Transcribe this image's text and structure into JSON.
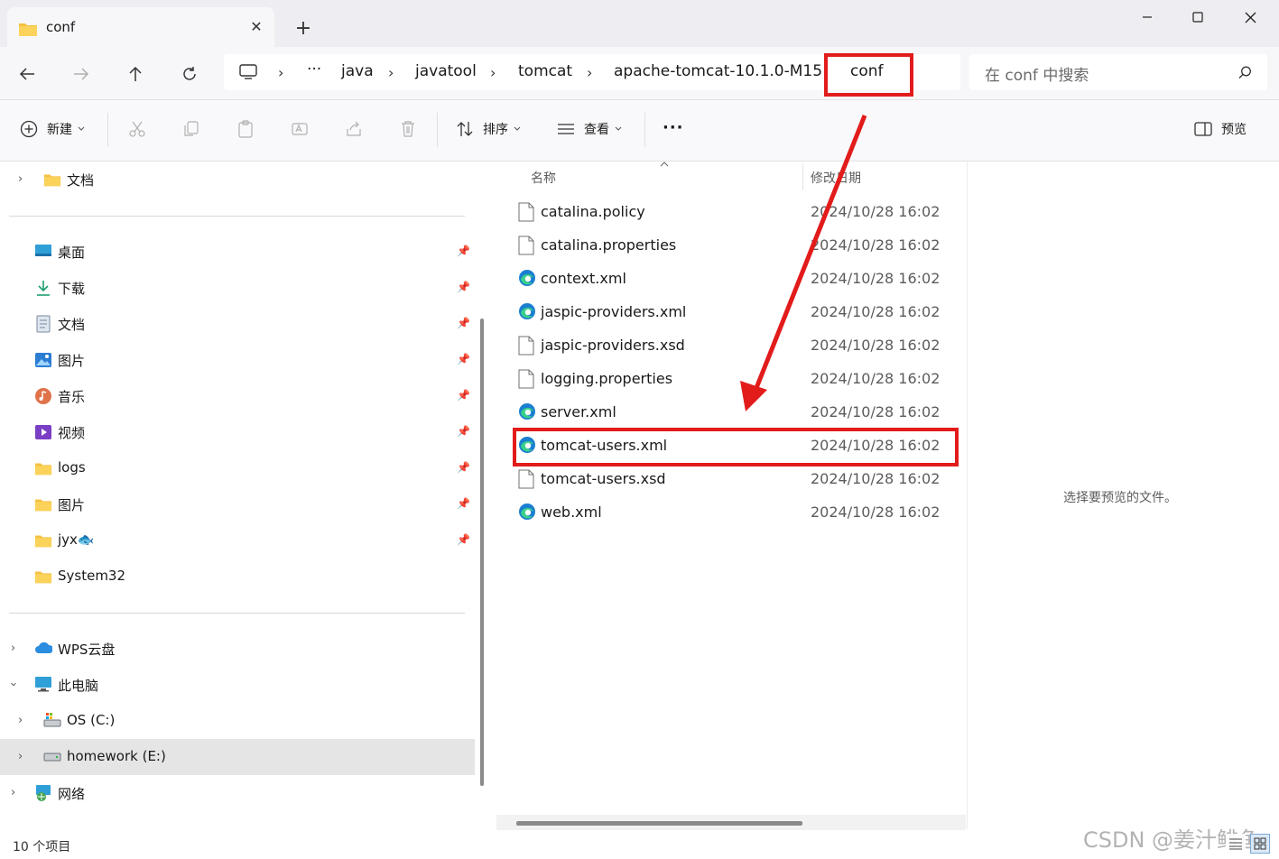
{
  "window": {
    "tab_title": "conf",
    "tab_close": "✕",
    "new_tab": "+"
  },
  "address_bar": {
    "ellipsis": "···",
    "crumbs": [
      "java",
      "javatool",
      "tomcat",
      "apache-tomcat-10.1.0-M15",
      "conf"
    ],
    "separator": "›"
  },
  "search": {
    "placeholder": "在 conf 中搜索"
  },
  "toolbar": {
    "new_label": "新建",
    "sort_label": "排序",
    "view_label": "查看",
    "more_label": "···",
    "preview_label": "预览"
  },
  "sidebar": {
    "top_item": "文档",
    "quick_access": [
      "桌面",
      "下载",
      "文档",
      "图片",
      "音乐",
      "视频",
      "logs",
      "图片",
      "jyx🐟",
      "System32"
    ],
    "wps": "WPS云盘",
    "this_pc": "此电脑",
    "drives": [
      "OS (C:)",
      "homework (E:)"
    ],
    "network": "网络"
  },
  "file_list": {
    "col_name": "名称",
    "col_date": "修改日期",
    "files": [
      {
        "name": "catalina.policy",
        "date": "2024/10/28 16:02",
        "icon": "file-icon"
      },
      {
        "name": "catalina.properties",
        "date": "2024/10/28 16:02",
        "icon": "file-icon"
      },
      {
        "name": "context.xml",
        "date": "2024/10/28 16:02",
        "icon": "edge-icon"
      },
      {
        "name": "jaspic-providers.xml",
        "date": "2024/10/28 16:02",
        "icon": "edge-icon"
      },
      {
        "name": "jaspic-providers.xsd",
        "date": "2024/10/28 16:02",
        "icon": "file-icon"
      },
      {
        "name": "logging.properties",
        "date": "2024/10/28 16:02",
        "icon": "file-icon"
      },
      {
        "name": "server.xml",
        "date": "2024/10/28 16:02",
        "icon": "edge-icon"
      },
      {
        "name": "tomcat-users.xml",
        "date": "2024/10/28 16:02",
        "icon": "edge-icon"
      },
      {
        "name": "tomcat-users.xsd",
        "date": "2024/10/28 16:02",
        "icon": "file-icon"
      },
      {
        "name": "web.xml",
        "date": "2024/10/28 16:02",
        "icon": "edge-icon"
      }
    ]
  },
  "preview": {
    "message": "选择要预览的文件。"
  },
  "status": {
    "count": "10 个项目"
  },
  "watermark": "CSDN @姜汁鲱鱼",
  "colors": {
    "annotation_red": "#e21b1b",
    "folder_yellow": "#f4c142",
    "edge_blue": "#1b7fd1"
  }
}
